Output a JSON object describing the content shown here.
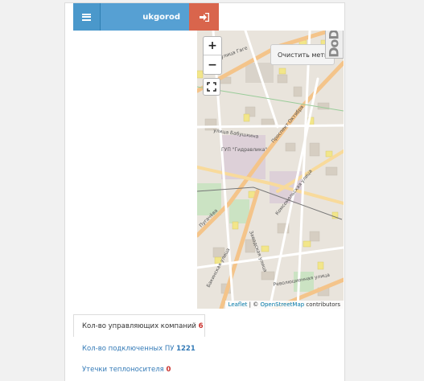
{
  "header": {
    "title": "ukgorod",
    "menu_icon": "hamburger-icon",
    "logout_icon": "sign-in-icon"
  },
  "map": {
    "zoom_in": "+",
    "zoom_out": "−",
    "fullscreen_icon": "fullscreen-icon",
    "clear_button": "Очистить метки",
    "side_tab_label": "DoDT",
    "attribution": {
      "leaflet": "Leaflet",
      "separator": " | © ",
      "osm": "OpenStreetMap",
      "suffix": " contributors"
    },
    "labels": {
      "street_1": "улица Бабушкина",
      "street_2": "Проспект Октября",
      "street_3": "Комсомольская улица",
      "street_4": "Революционная улица",
      "street_5": "Заводская улица",
      "poi_1": "ГУП \"Гидравлика\"",
      "street_6": "Бакинская улица",
      "street_7": "Пугачёва",
      "street_8": "улица Гаге"
    }
  },
  "stats": {
    "tab_label": "Кол-во управляющих компаний",
    "tab_value": "6",
    "line1_label": "Кол-во подключенных ПУ",
    "line1_value": "1221",
    "line2_label": "Утечки теплоносителя",
    "line2_value": "0"
  },
  "colors": {
    "primary": "#56a0d3",
    "danger": "#d9654c"
  }
}
